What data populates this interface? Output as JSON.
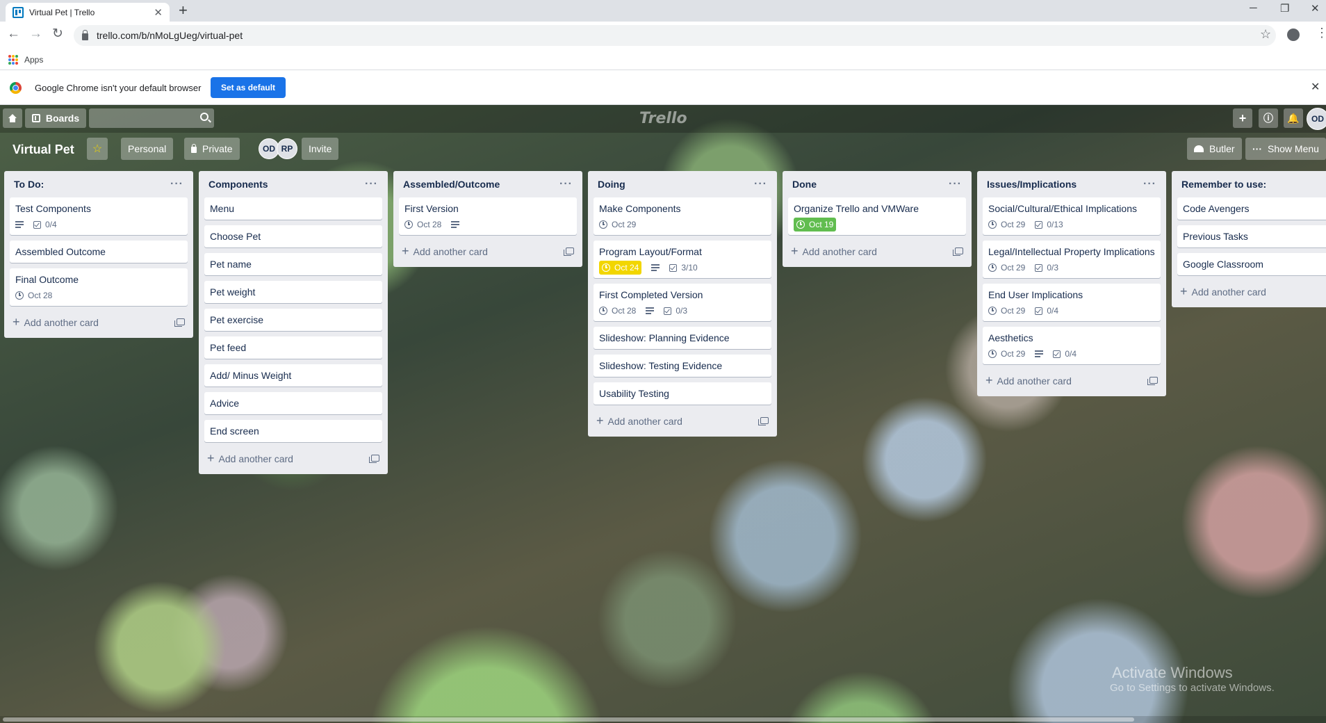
{
  "browser": {
    "tab_title": "Virtual Pet | Trello",
    "url": "trello.com/b/nMoLgUeg/virtual-pet",
    "bookmarks_apps": "Apps",
    "infobar_text": "Google Chrome isn't your default browser",
    "infobar_button": "Set as default"
  },
  "header": {
    "boards_label": "Boards",
    "logo": "Trello",
    "user_initials": "OD"
  },
  "board": {
    "title": "Virtual Pet",
    "team_label": "Personal",
    "visibility_label": "Private",
    "members": [
      "OD",
      "RP"
    ],
    "invite_label": "Invite",
    "butler_label": "Butler",
    "show_menu_label": "Show Menu",
    "add_card_label": "Add another card"
  },
  "lists": [
    {
      "title": "To Do:",
      "cards": [
        {
          "title": "Test Components",
          "desc": true,
          "checklist": "0/4"
        },
        {
          "title": "Assembled Outcome"
        },
        {
          "title": "Final Outcome",
          "due": "Oct 28"
        }
      ]
    },
    {
      "title": "Components",
      "cards": [
        {
          "title": "Menu"
        },
        {
          "title": "Choose Pet"
        },
        {
          "title": "Pet name"
        },
        {
          "title": "Pet weight"
        },
        {
          "title": "Pet exercise"
        },
        {
          "title": "Pet feed"
        },
        {
          "title": "Add/ Minus Weight"
        },
        {
          "title": "Advice"
        },
        {
          "title": "End screen"
        }
      ]
    },
    {
      "title": "Assembled/Outcome",
      "cards": [
        {
          "title": "First Version",
          "due": "Oct 28",
          "desc": true
        }
      ]
    },
    {
      "title": "Doing",
      "cards": [
        {
          "title": "Make Components",
          "due": "Oct 29"
        },
        {
          "title": "Program Layout/Format",
          "due": "Oct 24",
          "due_status": "yellow",
          "desc": true,
          "checklist": "3/10"
        },
        {
          "title": "First Completed Version",
          "due": "Oct 28",
          "desc": true,
          "checklist": "0/3"
        },
        {
          "title": "Slideshow: Planning Evidence"
        },
        {
          "title": "Slideshow: Testing Evidence"
        },
        {
          "title": "Usability Testing"
        }
      ]
    },
    {
      "title": "Done",
      "cards": [
        {
          "title": "Organize Trello and VMWare",
          "due": "Oct 19",
          "due_status": "green"
        }
      ]
    },
    {
      "title": "Issues/Implications",
      "cards": [
        {
          "title": "Social/Cultural/Ethical Implications",
          "due": "Oct 29",
          "checklist": "0/13"
        },
        {
          "title": "Legal/Intellectual Property Implications",
          "due": "Oct 29",
          "checklist": "0/3"
        },
        {
          "title": "End User Implications",
          "due": "Oct 29",
          "checklist": "0/4"
        },
        {
          "title": "Aesthetics",
          "due": "Oct 29",
          "desc": true,
          "checklist": "0/4"
        }
      ]
    },
    {
      "title": "Remember to use:",
      "cards": [
        {
          "title": "Code Avengers"
        },
        {
          "title": "Previous Tasks"
        },
        {
          "title": "Google Classroom"
        }
      ]
    }
  ],
  "watermark": {
    "line1": "Activate Windows",
    "line2": "Go to Settings to activate Windows."
  },
  "colors": {
    "due_yellow": "#f2d600",
    "due_green": "#61bd4f",
    "chrome_blue": "#1a73e8"
  }
}
